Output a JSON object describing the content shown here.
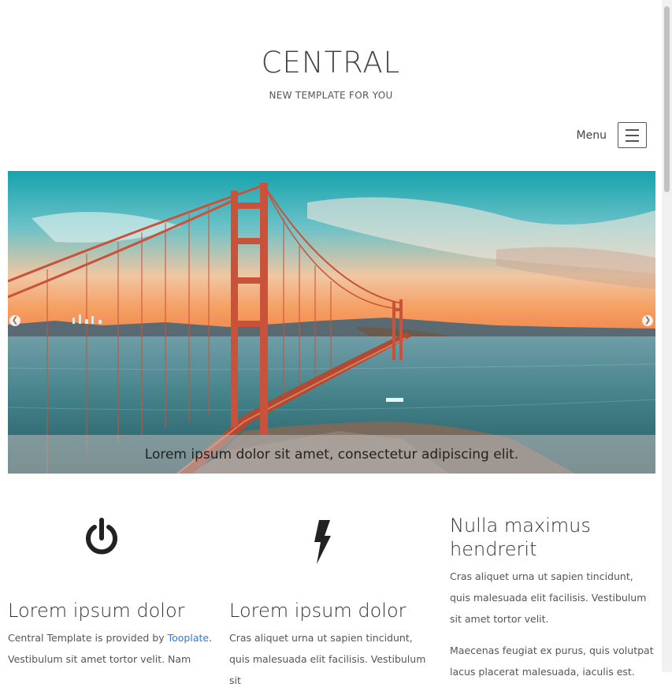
{
  "header": {
    "title": "CENTRAL",
    "tagline": "NEW TEMPLATE FOR YOU",
    "menu_label": "Menu",
    "menu_icon": "hamburger-icon"
  },
  "hero": {
    "caption": "Lorem ipsum dolor sit amet, consectetur adipiscing elit.",
    "prev_icon": "chevron-left-icon",
    "next_icon": "chevron-right-icon"
  },
  "features": [
    {
      "icon": "power-icon",
      "heading": "Lorem ipsum dolor",
      "text_before_link": "Central Template is provided by ",
      "link_text": "Tooplate",
      "text_after_link": ". Vestibulum sit amet tortor velit. Nam"
    },
    {
      "icon": "lightning-icon",
      "heading": "Lorem ipsum dolor",
      "text": "Cras aliquet urna ut sapien tincidunt, quis malesuada elit facilisis. Vestibulum sit"
    },
    {
      "heading": "Nulla maximus hendrerit",
      "text1": "Cras aliquet urna ut sapien tincidunt, quis malesuada elit facilisis. Vestibulum sit amet tortor velit.",
      "text2": "Maecenas feugiat ex purus, quis volutpat lacus placerat malesuada, iaculis est."
    }
  ],
  "colors": {
    "link": "#2a7ae2",
    "bridge": "#c8533a",
    "sky_top": "#1fa5a8",
    "sunset": "#f2a56a"
  }
}
